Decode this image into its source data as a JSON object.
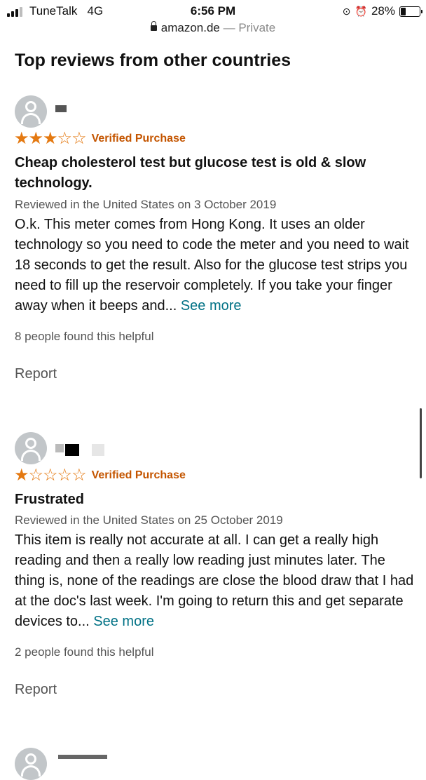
{
  "status": {
    "carrier": "TuneTalk",
    "network": "4G",
    "time": "6:56 PM",
    "battery": "28%",
    "battery_level": 0.28
  },
  "url_bar": {
    "domain": "amazon.de",
    "mode": " — Private"
  },
  "section_title": "Top reviews from other countries",
  "reviews": [
    {
      "stars": 3,
      "stars_display": "★★★☆☆",
      "verified": "Verified Purchase",
      "title": "Cheap cholesterol test but glucose test is old & slow technology.",
      "date": "Reviewed in the United States on 3 October 2019",
      "body": "O.k. This meter comes from Hong Kong. It uses an older technology so you need to code the meter and you need to wait 18 seconds to get the result. Also for the glucose test strips you need to fill up the reservoir completely. If you take your finger away when it beeps and...",
      "see_more": "See more",
      "helpful": "8 people found this helpful",
      "report": "Report"
    },
    {
      "stars": 1,
      "stars_display": "★☆☆☆☆",
      "verified": "Verified Purchase",
      "title": "Frustrated",
      "date": "Reviewed in the United States on 25 October 2019",
      "body": "This item is really not accurate at all. I can get a really high reading and then a really low reading just minutes later. The thing is, none of the readings are close the blood draw that I had at the doc's last week. I'm going to return this and get separate devices to...",
      "see_more": "See more",
      "helpful": "2 people found this helpful",
      "report": "Report"
    }
  ],
  "colors": {
    "star": "#e47911",
    "verified": "#c45500",
    "link": "#007185",
    "muted": "#555555"
  }
}
